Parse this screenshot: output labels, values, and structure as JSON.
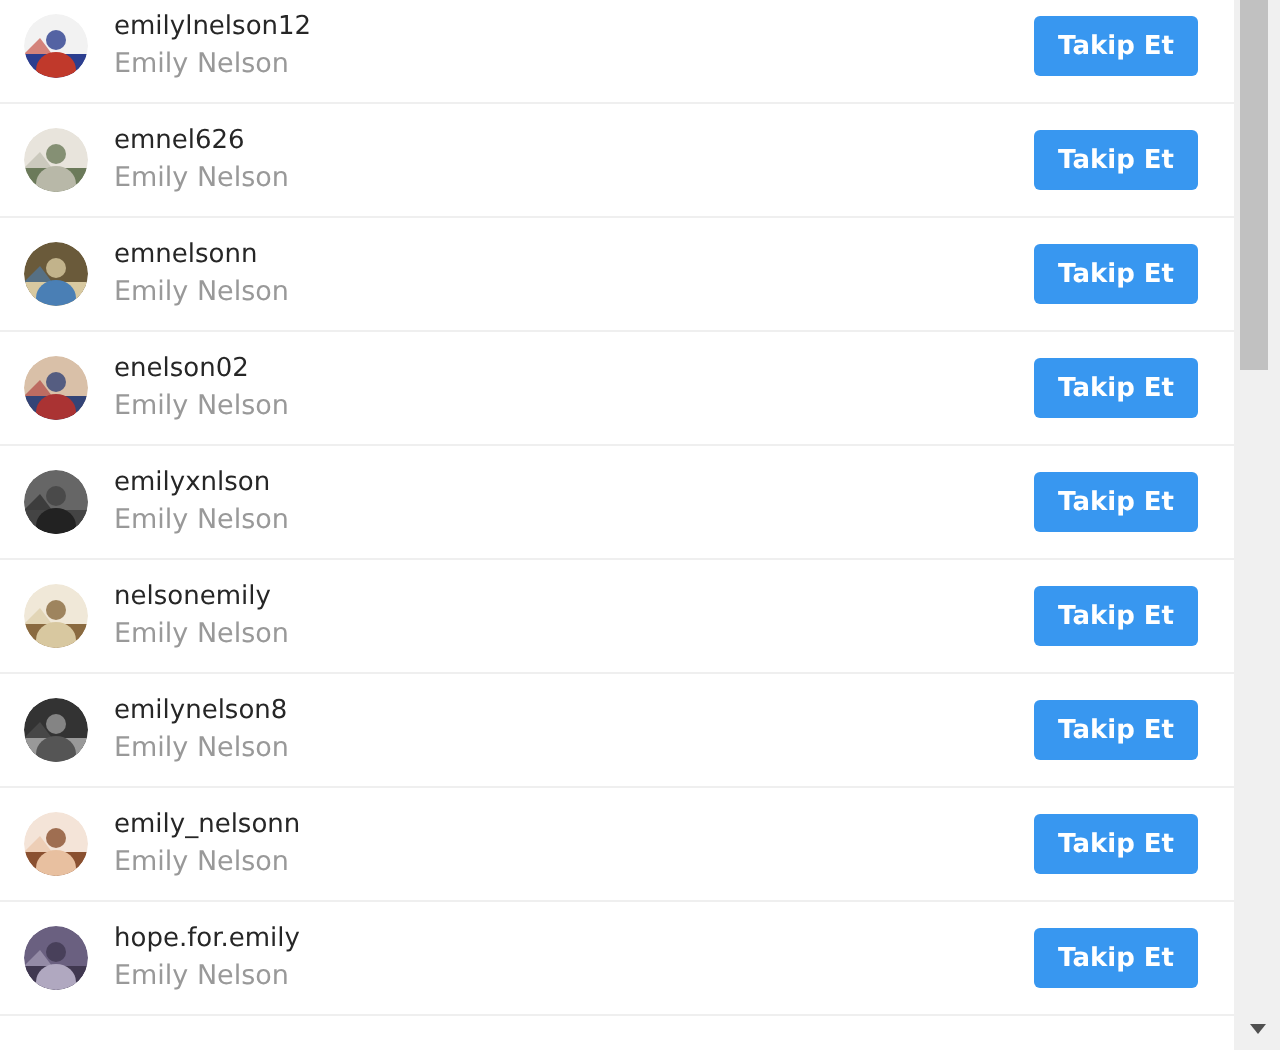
{
  "users": [
    {
      "username": "emilylnelson12",
      "name": "Emily Nelson",
      "button": "Takip Et"
    },
    {
      "username": "emnel626",
      "name": "Emily Nelson",
      "button": "Takip Et"
    },
    {
      "username": "emnelsonn",
      "name": "Emily Nelson",
      "button": "Takip Et"
    },
    {
      "username": "enelson02",
      "name": "Emily Nelson",
      "button": "Takip Et"
    },
    {
      "username": "emilyxnlson",
      "name": "Emily Nelson",
      "button": "Takip Et"
    },
    {
      "username": "nelsonemily",
      "name": "Emily Nelson",
      "button": "Takip Et"
    },
    {
      "username": "emilynelson8",
      "name": "Emily Nelson",
      "button": "Takip Et"
    },
    {
      "username": "emily_nelsonn",
      "name": "Emily Nelson",
      "button": "Takip Et"
    },
    {
      "username": "hope.for.emily",
      "name": "Emily Nelson",
      "button": "Takip Et"
    }
  ]
}
